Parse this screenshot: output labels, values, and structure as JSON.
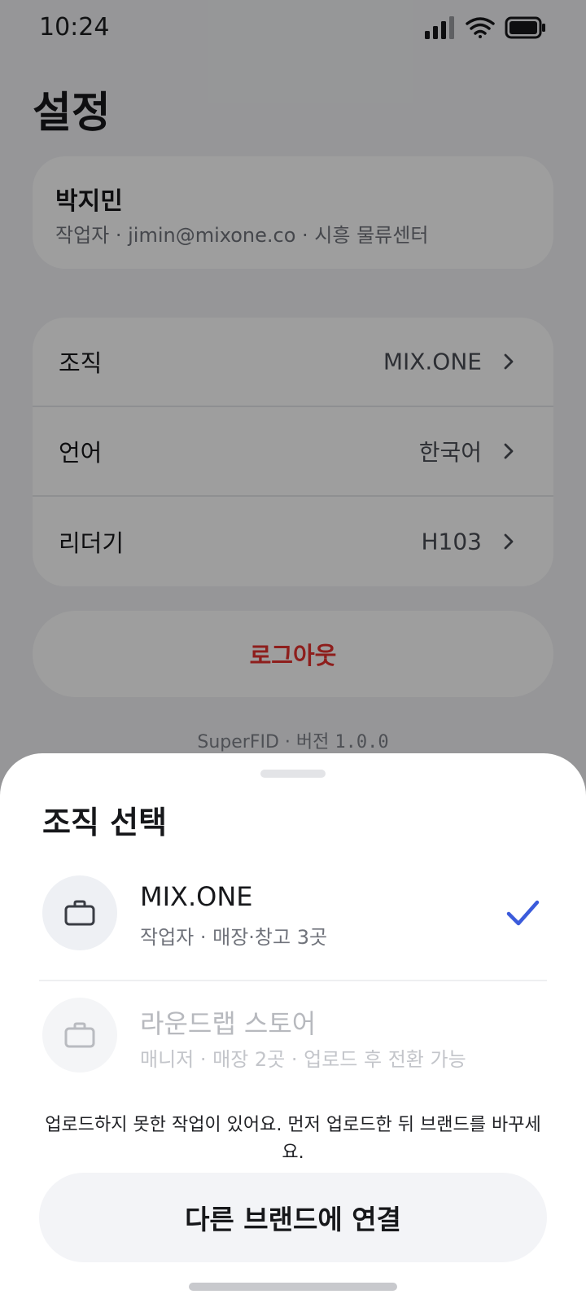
{
  "status_bar": {
    "time": "10:24",
    "icons": [
      "signal-icon",
      "wifi-icon",
      "battery-icon"
    ]
  },
  "settings": {
    "title": "설정",
    "profile": {
      "name": "박지민",
      "subtitle": "작업자 · jimin@mixone.co · 시흥 물류센터"
    },
    "menu": [
      {
        "label": "조직",
        "value": "MIX.ONE"
      },
      {
        "label": "언어",
        "value": "한국어"
      },
      {
        "label": "리더기",
        "value": "H103"
      }
    ],
    "logout_label": "로그아웃",
    "version_prefix": "SuperFID · 버전 ",
    "version_number": "1.0.0"
  },
  "sheet": {
    "title": "조직 선택",
    "options": [
      {
        "name": "MIX.ONE",
        "meta": "작업자 · 매장·창고 3곳",
        "selected": true,
        "disabled": false
      },
      {
        "name": "라운드랩 스토어",
        "meta": "매니저 · 매장 2곳 · 업로드 후 전환 가능",
        "selected": false,
        "disabled": true
      }
    ],
    "warning": "업로드하지 못한 작업이 있어요. 먼저 업로드한 뒤 브랜드를 바꾸세요.",
    "connect_label": "다른 브랜드에 연결"
  },
  "colors": {
    "accent": "#3b5bdb",
    "danger": "#e5312e",
    "text_primary": "#17181b",
    "text_secondary": "#70737b"
  }
}
